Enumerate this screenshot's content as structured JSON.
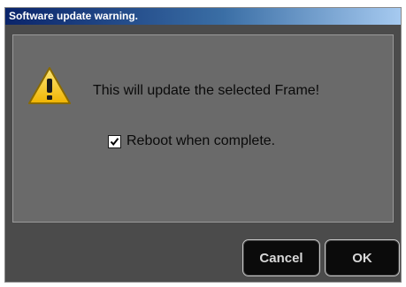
{
  "window": {
    "title": "Software update warning."
  },
  "dialog": {
    "icon": "warning-icon",
    "message": "This will update the selected Frame!",
    "reboot_checkbox": {
      "label": "Reboot when complete.",
      "checked": true
    }
  },
  "buttons": {
    "cancel_label": "Cancel",
    "ok_label": "OK"
  },
  "colors": {
    "title_bar_start": "#0a246a",
    "title_bar_end": "#a6caf0",
    "dialog_background": "#4b4b4b",
    "panel_background": "#6a6a6a",
    "button_background": "#0b0b0b",
    "warning_yellow": "#f4c20d"
  }
}
